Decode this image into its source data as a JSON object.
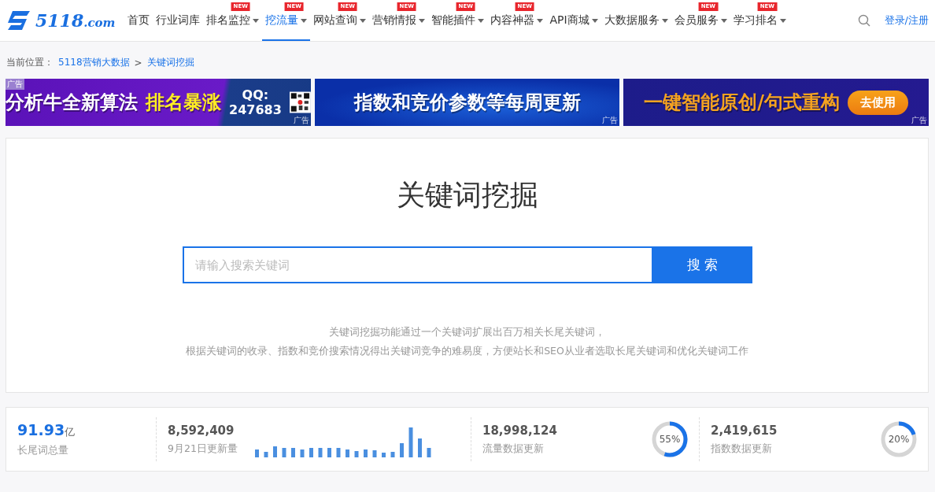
{
  "logo": {
    "number": "5118",
    "suffix": ".com"
  },
  "nav": [
    {
      "label": "首页",
      "dropdown": false,
      "selected": false
    },
    {
      "label": "行业词库",
      "dropdown": false,
      "selected": false
    },
    {
      "label": "排名监控",
      "dropdown": true,
      "badge": "NEW",
      "selected": false
    },
    {
      "label": "挖流量",
      "dropdown": true,
      "badge": "NEW",
      "selected": true
    },
    {
      "label": "网站查询",
      "dropdown": true,
      "badge": "NEW",
      "selected": false
    },
    {
      "label": "营销情报",
      "dropdown": true,
      "badge": "NEW",
      "selected": false
    },
    {
      "label": "智能插件",
      "dropdown": true,
      "badge": "NEW",
      "selected": false
    },
    {
      "label": "内容神器",
      "dropdown": true,
      "badge": "NEW",
      "selected": false
    },
    {
      "label": "API商城",
      "dropdown": true,
      "selected": false
    },
    {
      "label": "大数据服务",
      "dropdown": true,
      "selected": false
    },
    {
      "label": "会员服务",
      "dropdown": true,
      "badge": "NEW",
      "selected": false
    },
    {
      "label": "学习排名",
      "dropdown": true,
      "badge": "NEW",
      "selected": false
    }
  ],
  "login": "登录/注册",
  "breadcrumb": {
    "prefix": "当前位置：",
    "items": [
      "5118营销大数据",
      "关键词挖掘"
    ],
    "separator": ">"
  },
  "banners": [
    {
      "kind": "promo",
      "ad_tag": "广告",
      "text": "分析牛全新算法",
      "highlight": "排名暴涨",
      "qq_label": "QQ:",
      "qq_number": "247683",
      "ad_mark": "广告"
    },
    {
      "kind": "plain",
      "text": "指数和竞价参数等每周更新",
      "ad_mark": "广告"
    },
    {
      "kind": "cta",
      "text": "一键智能原创/句式重构",
      "button": "去使用",
      "ad_mark": "广告"
    }
  ],
  "title": "关键词挖掘",
  "search": {
    "placeholder": "请输入搜索关键词",
    "button": "搜 索"
  },
  "description": [
    "关键词挖掘功能通过一个关键词扩展出百万相关长尾关键词，",
    "根据关键词的收录、指数和竞价搜索情况得出关键词竞争的难易度，方便站长和SEO从业者选取长尾关键词和优化关键词工作"
  ],
  "stats": [
    {
      "kind": "total",
      "value": "91.93",
      "unit": "亿",
      "label": "长尾词总量"
    },
    {
      "kind": "bars",
      "value": "8,592,409",
      "label": "9月21日更新量"
    },
    {
      "kind": "ring",
      "value": "18,998,124",
      "label": "流量数据更新",
      "level": 0.55,
      "reading": "55%"
    },
    {
      "kind": "ring",
      "value": "2,419,615",
      "label": "指数数据更新",
      "level": 0.2,
      "reading": "20%"
    }
  ]
}
